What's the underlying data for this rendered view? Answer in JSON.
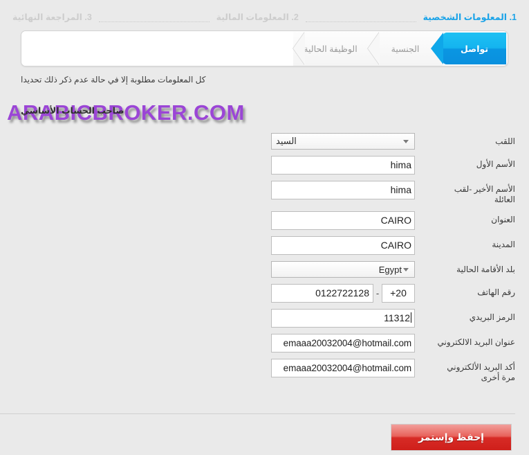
{
  "steps": [
    {
      "label": "1. المعلومات الشخصية",
      "state": "active"
    },
    {
      "label": "2. المعلومات المالية",
      "state": "inactive"
    },
    {
      "label": "3. المراجعة النهائية",
      "state": "inactive"
    }
  ],
  "tabs": [
    {
      "label": "تواصل",
      "state": "active"
    },
    {
      "label": "الجنسية",
      "state": "inactive"
    },
    {
      "label": "الوظيفة الحالية",
      "state": "inactive"
    }
  ],
  "hint": "كل المعلومات مطلوبة إلا في حالة عدم ذكر ذلك تحديدا",
  "section_title": "صاحب الحساب الأساسي",
  "watermark": "ARABICBROKER.COM",
  "fields": {
    "title": {
      "label": "اللقب",
      "value": "السيد",
      "type": "select"
    },
    "first_name": {
      "label": "الأسم الأول",
      "value": "hima",
      "type": "text"
    },
    "last_name": {
      "label_line1": "الأسم الأخير -لقب",
      "label_line2": "العائلة",
      "value": "hima",
      "type": "text"
    },
    "address": {
      "label": "العنوان",
      "value": "CAIRO",
      "type": "text"
    },
    "city": {
      "label": "المدينة",
      "value": "CAIRO",
      "type": "text"
    },
    "country": {
      "label": "بلد الأقامة الحالية",
      "value": "Egypt",
      "type": "select"
    },
    "phone": {
      "label": "رقم الهاتف",
      "country_code": "20+",
      "separator": "-",
      "number": "0122722128",
      "type": "phone"
    },
    "postal_code": {
      "label": "الرمز البريدي",
      "value": "11312",
      "type": "text",
      "focused": true
    },
    "email": {
      "label": "عنوان البريد الالكتروني",
      "value": "emaaa20032004@hotmail.com",
      "type": "text"
    },
    "email_confirm": {
      "label_line1": "أكد البريد الألكتروني",
      "label_line2": "مرة أخرى",
      "value": "emaaa20032004@hotmail.com",
      "type": "text"
    }
  },
  "submit": {
    "label": "إحفظ وإستمر"
  },
  "colors": {
    "page_bg": "#eaeaea",
    "accent_blue": "#0fa7e9",
    "submit_red": "#d72b26",
    "watermark_purple": "#9b45d6",
    "inactive_step": "#cdcdcd"
  }
}
